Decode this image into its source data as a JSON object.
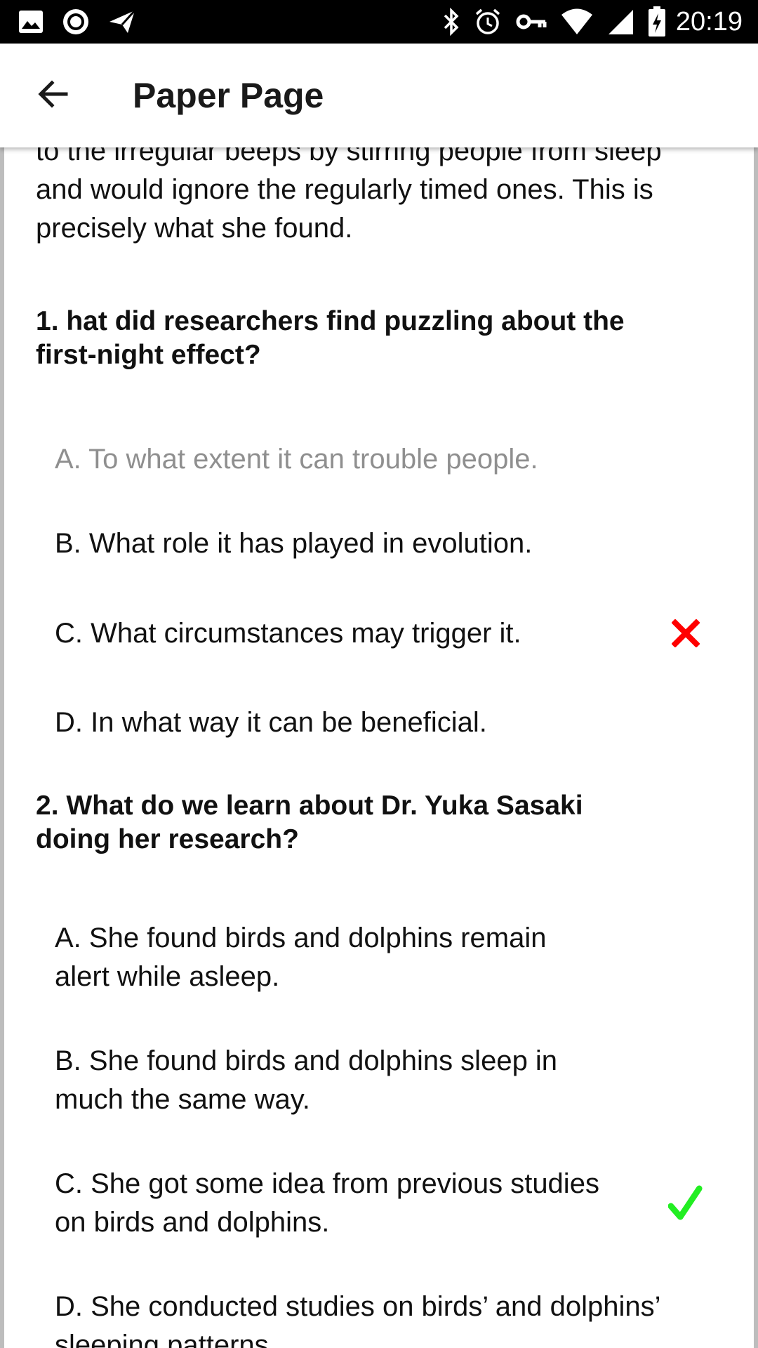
{
  "status_bar": {
    "time": "20:19",
    "left_icons": [
      "image-icon",
      "record-icon",
      "send-icon"
    ],
    "right_icons": [
      "bluetooth-icon",
      "alarm-icon",
      "vpn-key-icon",
      "wifi-icon",
      "signal-icon",
      "battery-charging-icon"
    ]
  },
  "app_bar": {
    "back_icon": "arrow-back-icon",
    "title": "Paper Page"
  },
  "passage": {
    "lines": [
      "to the irregular beeps by stirring people from sleep",
      "and would ignore the regularly timed ones. This is",
      "precisely what she found."
    ]
  },
  "questions": [
    {
      "number": "1.",
      "text_lines": [
        "1. hat did researchers find puzzling about the",
        "first-night effect?"
      ],
      "options": [
        {
          "lines": [
            "A. To what extent it can trouble people."
          ],
          "dimmed": true,
          "mark": ""
        },
        {
          "lines": [
            "B. What role it has played in evolution."
          ],
          "dimmed": false,
          "mark": ""
        },
        {
          "lines": [
            "C. What circumstances may trigger it."
          ],
          "dimmed": false,
          "mark": "wrong"
        },
        {
          "lines": [
            "D. In what way it can be beneficial."
          ],
          "dimmed": false,
          "mark": ""
        }
      ]
    },
    {
      "number": "2.",
      "text_lines": [
        "2. What do we learn about Dr. Yuka Sasaki",
        "doing her research?"
      ],
      "options": [
        {
          "lines": [
            "A. She found birds and dolphins remain",
            "alert while asleep."
          ],
          "dimmed": false,
          "mark": ""
        },
        {
          "lines": [
            "B. She found birds and dolphins sleep in",
            "much the same way."
          ],
          "dimmed": false,
          "mark": ""
        },
        {
          "lines": [
            "C. She got some idea from previous studies",
            "on birds and dolphins."
          ],
          "dimmed": false,
          "mark": "correct"
        },
        {
          "lines": [
            "D. She conducted studies on birds’ and dolphins’",
            "sleeping patterns."
          ],
          "dimmed": false,
          "mark": ""
        }
      ]
    }
  ],
  "colors": {
    "wrong_mark": "#ff0000",
    "correct_mark": "#22ee22",
    "dimmed_text": "#8f8f8f",
    "status_bar": "#000000"
  }
}
